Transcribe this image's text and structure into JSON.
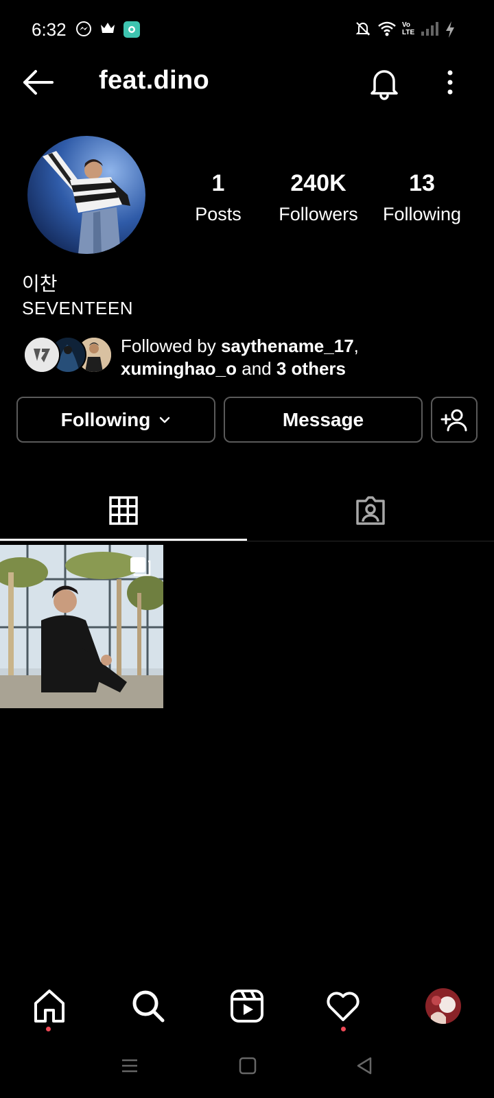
{
  "status_bar": {
    "time": "6:32",
    "left_icons": [
      "messenger-icon",
      "crown-icon",
      "app-notification-icon"
    ],
    "right_icons": [
      "bell-muted-icon",
      "wifi-icon",
      "volte-icon",
      "signal-icon",
      "charging-icon"
    ],
    "volte_text": "Vo LTE"
  },
  "header": {
    "username": "feat.dino",
    "icons": [
      "back-arrow-icon",
      "bell-icon",
      "more-vertical-icon"
    ]
  },
  "profile": {
    "stats": [
      {
        "value": "1",
        "label": "Posts"
      },
      {
        "value": "240K",
        "label": "Followers"
      },
      {
        "value": "13",
        "label": "Following"
      }
    ],
    "name": "이찬",
    "bio": "SEVENTEEN",
    "followed_by": {
      "prefix": "Followed by ",
      "user1": "saythename_17",
      "separator": ",",
      "user2": "xuminghao_o",
      "middle": " and ",
      "others": "3 others"
    }
  },
  "actions": {
    "following_label": "Following",
    "message_label": "Message",
    "add_user_icon": "add-person-icon"
  },
  "tabs": [
    {
      "icon": "grid-icon",
      "active": true
    },
    {
      "icon": "tagged-person-icon",
      "active": false
    }
  ],
  "posts": [
    {
      "type": "multi-image",
      "icon": "carousel-icon"
    }
  ],
  "bottom_nav": {
    "items": [
      "home-icon",
      "search-icon",
      "reels-icon",
      "heart-icon",
      "profile-avatar"
    ],
    "badges": [
      "home-icon",
      "heart-icon"
    ]
  },
  "colors": {
    "background": "#000000",
    "text": "#ffffff",
    "button_border": "#5a5a5a",
    "badge": "#ed4956",
    "app_icon": "#3ec4b0"
  }
}
